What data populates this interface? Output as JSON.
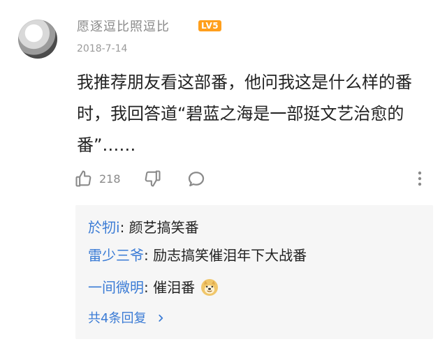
{
  "comment": {
    "username": "愿逐逗比照逗比",
    "level_badge": "LV5",
    "date": "2018-7-14",
    "text": "我推荐朋友看这部番，他问我这是什么样的番时，我回答道“碧蓝之海是一部挺文艺治愈的番”……",
    "like_count": "218",
    "icons": {
      "avatar": "avatar-image",
      "like": "thumbs-up-icon",
      "dislike": "thumbs-down-icon",
      "comment": "speech-bubble-icon",
      "more": "vertical-ellipsis-icon"
    }
  },
  "replies": {
    "items": [
      {
        "name": "於牣i",
        "sep": ": ",
        "text": "颜艺搞笑番"
      },
      {
        "name": "雷少三爷",
        "sep": ": ",
        "text": "励志搞笑催泪年下大战番"
      },
      {
        "name": "一间微明",
        "sep": ": ",
        "text": "催泪番",
        "emoji": "doge-emoji"
      }
    ],
    "all_replies_label": "共4条回复"
  },
  "colors": {
    "username": "#8a8a8a",
    "reply_name": "#3a7bd5",
    "badge_bg": "#ff9f1c",
    "reply_box_bg": "#f6f6f6"
  }
}
